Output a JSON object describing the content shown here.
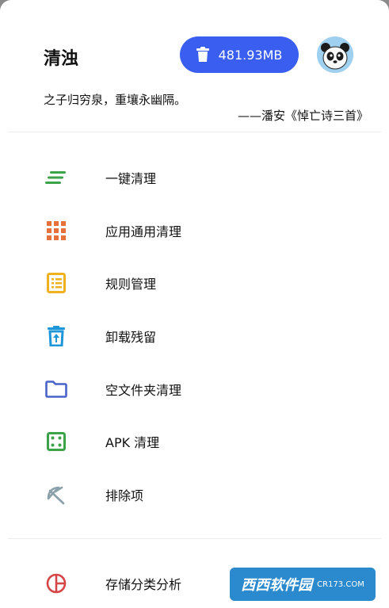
{
  "header": {
    "title": "清浊",
    "storage_size": "481.93MB",
    "avatar_icon": "panda-avatar-icon"
  },
  "quote": {
    "text": "之子归穷泉，重壤永幽隔。",
    "author": "——潘安《悼亡诗三首》"
  },
  "menu": [
    {
      "label": "一键清理",
      "icon": "quick-clean-icon",
      "color": "#3da34a"
    },
    {
      "label": "应用通用清理",
      "icon": "grid-apps-icon",
      "color": "#e8703a"
    },
    {
      "label": "规则管理",
      "icon": "rule-list-icon",
      "color": "#efb21e"
    },
    {
      "label": "卸载残留",
      "icon": "uninstall-trash-icon",
      "color": "#1e97d9"
    },
    {
      "label": "空文件夹清理",
      "icon": "folder-icon",
      "color": "#4a63c9"
    },
    {
      "label": "APK 清理",
      "icon": "dice-icon",
      "color": "#3da34a"
    },
    {
      "label": "排除项",
      "icon": "exclude-icon",
      "color": "#8aa0aa"
    },
    {
      "label": "存储分类分析",
      "icon": "pie-analysis-icon",
      "color": "#d64545"
    }
  ],
  "watermark": {
    "text": "西西软件园",
    "sub": "CR173.COM"
  }
}
